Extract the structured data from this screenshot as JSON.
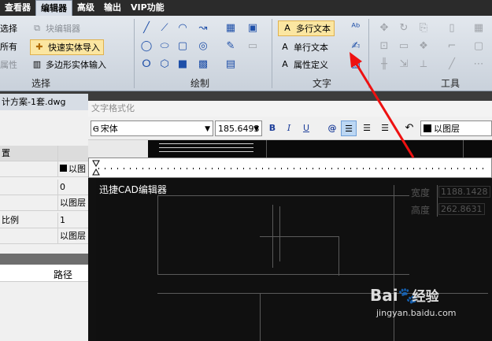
{
  "menu": {
    "tabs": [
      "查看器",
      "编辑器",
      "高级",
      "输出",
      "VIP功能"
    ]
  },
  "ribbon": {
    "select_group": {
      "label": "选择",
      "buttons": [
        "选择",
        "所有",
        "属性",
        "块编辑器",
        "快速实体导入",
        "多边形实体输入"
      ]
    },
    "draw_group": {
      "label": "绘制"
    },
    "text_group": {
      "label": "文字",
      "buttons": [
        "多行文本",
        "单行文本",
        "属性定义"
      ]
    },
    "tools_group": {
      "label": "工具"
    }
  },
  "file_tab": {
    "name": "计方案-1套.dwg"
  },
  "properties": {
    "rows": [
      {
        "key": "置",
        "value": ""
      },
      {
        "key": "",
        "value": "以图"
      },
      {
        "key": "",
        "value": "0"
      },
      {
        "key": "",
        "value": "以图层"
      },
      {
        "key": "比例",
        "value": "1"
      },
      {
        "key": "",
        "value": "以图层"
      }
    ],
    "path_header": "路径",
    "colors": {
      "layer_swatch": "#000000"
    }
  },
  "dialog": {
    "title": "文字格式化",
    "font": "宋体",
    "size": "185.6493",
    "bold": "B",
    "italic": "I",
    "underline": "U",
    "at": "@",
    "color": "以图层",
    "editor_text": "迅捷CAD编辑器"
  },
  "drawing": {
    "labels": [
      "宽度",
      "1188.1428",
      "高度",
      "262.8631"
    ]
  },
  "watermark": {
    "brand": "Bai",
    "suffix": "经验",
    "url": "jingyan.baidu.com"
  },
  "accent": "#e0b14e"
}
